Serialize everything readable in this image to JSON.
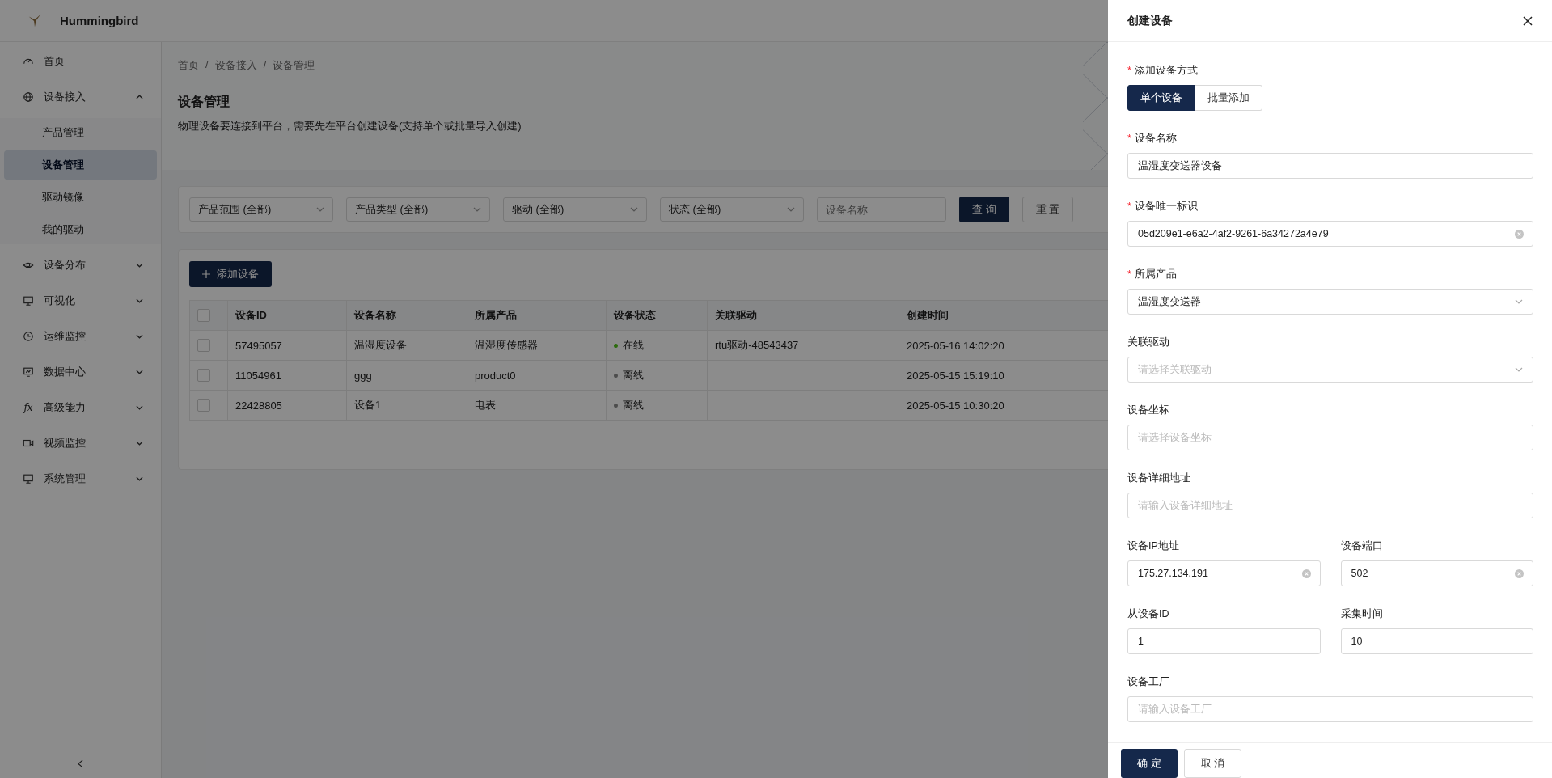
{
  "app": {
    "name": "Hummingbird"
  },
  "sidebar": {
    "items": [
      {
        "label": "首页",
        "selected": false
      },
      {
        "label": "设备接入",
        "selected": false,
        "expanded": true,
        "children": [
          {
            "label": "产品管理",
            "selected": false
          },
          {
            "label": "设备管理",
            "selected": true
          },
          {
            "label": "驱动镜像",
            "selected": false
          },
          {
            "label": "我的驱动",
            "selected": false
          }
        ]
      },
      {
        "label": "设备分布",
        "selected": false,
        "expanded": false
      },
      {
        "label": "可视化",
        "selected": false,
        "expanded": false
      },
      {
        "label": "运维监控",
        "selected": false,
        "expanded": false
      },
      {
        "label": "数据中心",
        "selected": false,
        "expanded": false
      },
      {
        "label": "高级能力",
        "selected": false,
        "expanded": false,
        "icon_text": "fx"
      },
      {
        "label": "视频监控",
        "selected": false,
        "expanded": false
      },
      {
        "label": "系统管理",
        "selected": false,
        "expanded": false
      }
    ]
  },
  "breadcrumb": [
    "首页",
    "设备接入",
    "设备管理"
  ],
  "breadcrumb_separator": "/",
  "page": {
    "title": "设备管理",
    "description": "物理设备要连接到平台，需要先在平台创建设备(支持单个或批量导入创建)"
  },
  "filters": {
    "selects": [
      "产品范围 (全部)",
      "产品类型 (全部)",
      "驱动 (全部)",
      "状态 (全部)"
    ],
    "search": {
      "placeholder": "设备名称"
    },
    "buttons": [
      {
        "label": "查 询",
        "kind": "primary"
      },
      {
        "label": "重 置",
        "kind": "default"
      }
    ]
  },
  "add_button": "添加设备",
  "table": {
    "header_checked": false,
    "columns": [
      "设备ID",
      "设备名称",
      "所属产品",
      "设备状态",
      "关联驱动",
      "创建时间"
    ],
    "rows": [
      {
        "checked": false,
        "cells": [
          "57495057",
          "温湿度设备",
          "温湿度传感器",
          "在线",
          "rtu驱动-48543437",
          "2025-05-16 14:02:20"
        ],
        "online": true
      },
      {
        "checked": false,
        "cells": [
          "11054961",
          "ggg",
          "product0",
          "离线",
          "",
          "2025-05-15 15:19:10"
        ],
        "online": false
      },
      {
        "checked": false,
        "cells": [
          "22428805",
          "设备1",
          "电表",
          "离线",
          "",
          "2025-05-15 10:30:20"
        ],
        "online": false
      }
    ]
  },
  "drawer": {
    "title": "创建设备",
    "required_mark": "*",
    "rows": [
      [
        {
          "label": "添加设备方式",
          "required": true,
          "kind": "segmented",
          "options": [
            {
              "label": "单个设备",
              "selected": true
            },
            {
              "label": "批量添加",
              "selected": false
            }
          ]
        }
      ],
      [
        {
          "label": "设备名称",
          "required": true,
          "kind": "input",
          "value": "温湿度变送器设备"
        }
      ],
      [
        {
          "label": "设备唯一标识",
          "required": true,
          "kind": "input",
          "value": "05d209e1-e6a2-4af2-9261-6a34272a4e79",
          "clearable": true
        }
      ],
      [
        {
          "label": "所属产品",
          "required": true,
          "kind": "select",
          "value": "温湿度变送器"
        }
      ],
      [
        {
          "label": "关联驱动",
          "required": false,
          "kind": "select",
          "placeholder": "请选择关联驱动"
        }
      ],
      [
        {
          "label": "设备坐标",
          "required": false,
          "kind": "input",
          "placeholder": "请选择设备坐标"
        }
      ],
      [
        {
          "label": "设备详细地址",
          "required": false,
          "kind": "input",
          "placeholder": "请输入设备详细地址"
        }
      ],
      [
        {
          "label": "设备IP地址",
          "required": false,
          "kind": "input",
          "value": "175.27.134.191",
          "clearable": true
        },
        {
          "label": "设备端口",
          "required": false,
          "kind": "input",
          "value": "502",
          "clearable": true
        }
      ],
      [
        {
          "label": "从设备ID",
          "required": false,
          "kind": "input",
          "value": "1"
        },
        {
          "label": "采集时间",
          "required": false,
          "kind": "input",
          "value": "10"
        }
      ],
      [
        {
          "label": "设备工厂",
          "required": false,
          "kind": "input",
          "placeholder": "请输入设备工厂"
        }
      ]
    ],
    "buttons": [
      {
        "label": "确 定",
        "kind": "primary"
      },
      {
        "label": "取 消",
        "kind": "default"
      }
    ]
  }
}
